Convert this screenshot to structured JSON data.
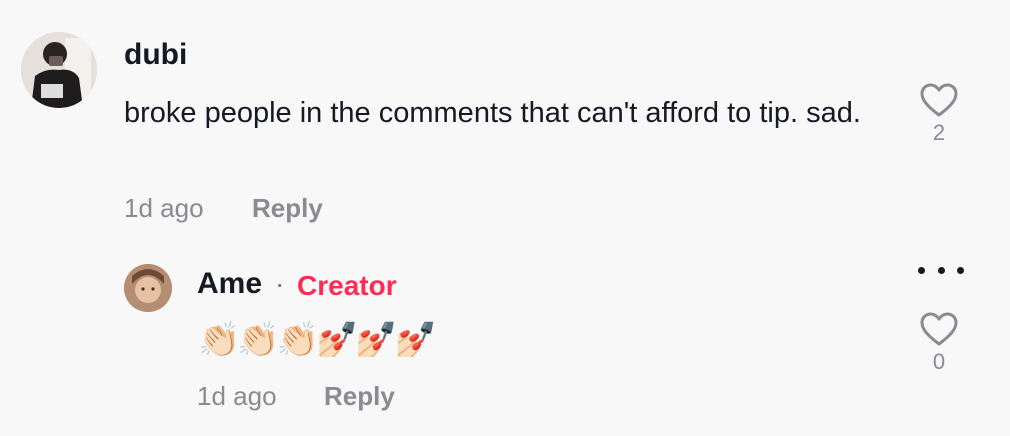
{
  "comment": {
    "username": "dubi",
    "text": "broke people in the comments that can't afford to tip. sad.",
    "time": "1d ago",
    "reply_label": "Reply",
    "like_count": "2"
  },
  "reply": {
    "username": "Ame",
    "separator": "·",
    "badge": "Creator",
    "text": "👏🏻👏🏻👏🏻💅🏻💅🏻💅🏻",
    "time": "1d ago",
    "reply_label": "Reply",
    "like_count": "0"
  },
  "colors": {
    "background": "#f8f8f8",
    "text": "#161823",
    "muted": "#8a8b91",
    "creator": "#fe2c55"
  },
  "icons": [
    "heart-outline-icon",
    "more-horizontal-icon"
  ]
}
